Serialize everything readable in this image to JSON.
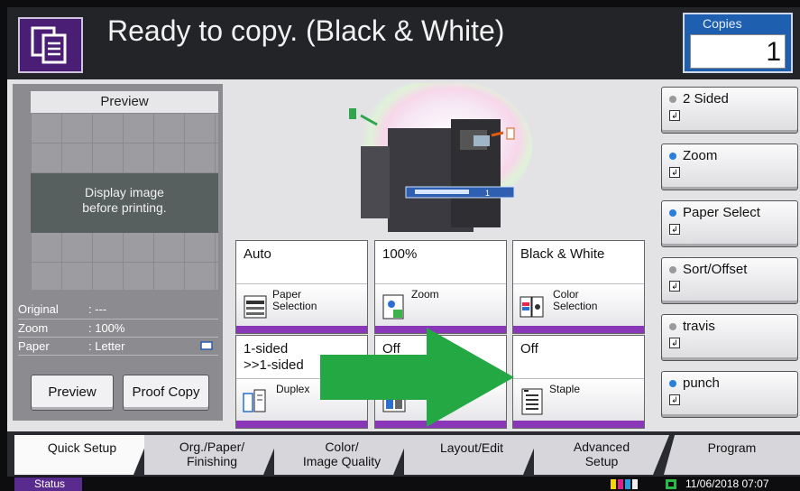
{
  "header": {
    "title": "Ready to copy. (Black & White)",
    "copies_label": "Copies",
    "copies_value": "1"
  },
  "preview": {
    "title": "Preview",
    "placeholder_line1": "Display image",
    "placeholder_line2": "before printing.",
    "info": [
      {
        "label": "Original",
        "value": ": ---"
      },
      {
        "label": "Zoom",
        "value": ": 100%"
      },
      {
        "label": "Paper",
        "value": ": Letter"
      }
    ],
    "preview_button": "Preview",
    "proof_copy_button": "Proof Copy"
  },
  "functions": [
    {
      "value": "Auto",
      "label_line1": "Paper",
      "label_line2": "Selection",
      "icon": "paper-tray-icon"
    },
    {
      "value": "100%",
      "label_line1": "Zoom",
      "label_line2": "",
      "icon": "zoom-icon"
    },
    {
      "value": "Black & White",
      "label_line1": "Color",
      "label_line2": "Selection",
      "icon": "color-selection-icon"
    },
    {
      "value_line1": "1-sided",
      "value_line2": ">>1-sided",
      "label_line1": "Duplex",
      "icon": "duplex-icon"
    },
    {
      "value": "Off",
      "icon": "combine-icon"
    },
    {
      "value": "Off",
      "label_line1": "Staple",
      "icon": "staple-icon"
    }
  ],
  "shortcuts": [
    {
      "label": "2 Sided",
      "dot": "#9a9a9a"
    },
    {
      "label": "Zoom",
      "dot": "#2a7fd8"
    },
    {
      "label": "Paper Select",
      "dot": "#2a7fd8"
    },
    {
      "label": "Sort/Offset",
      "dot": "#9a9a9a"
    },
    {
      "label": "travis",
      "dot": "#9a9a9a"
    },
    {
      "label": "punch",
      "dot": "#2a7fd8"
    }
  ],
  "tabs": [
    {
      "line1": "Quick Setup",
      "line2": ""
    },
    {
      "line1": "Org./Paper/",
      "line2": "Finishing"
    },
    {
      "line1": "Color/",
      "line2": "Image Quality"
    },
    {
      "line1": "Layout/Edit",
      "line2": ""
    },
    {
      "line1": "Advanced",
      "line2": "Setup"
    },
    {
      "line1": "Program",
      "line2": ""
    }
  ],
  "status": {
    "button": "Status",
    "datetime": "11/06/2018  07:07"
  },
  "colors": {
    "accent": "#8a36b8",
    "header_icon": "#4b1e75",
    "copies_box": "#1f5fb0",
    "overlay_arrow": "#23a843"
  }
}
